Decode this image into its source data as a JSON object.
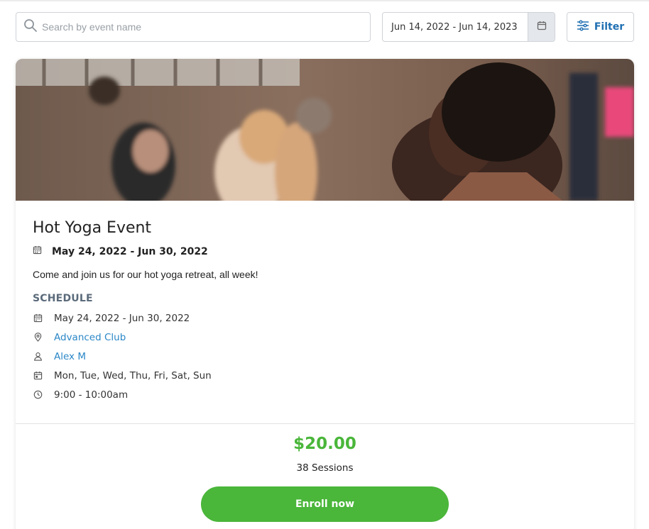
{
  "toolbar": {
    "search_placeholder": "Search by event name",
    "search_value": "",
    "date_range": "Jun 14, 2022 - Jun 14, 2023",
    "filter_label": "Filter"
  },
  "event": {
    "title": "Hot Yoga Event",
    "date_range": "May 24, 2022 - Jun 30, 2022",
    "description": "Come and join us for our hot yoga retreat, all week!",
    "schedule_heading": "SCHEDULE",
    "schedule": {
      "dates": "May 24, 2022 - Jun 30, 2022",
      "location": "Advanced Club",
      "instructor": "Alex M",
      "days": "Mon, Tue, Wed, Thu, Fri, Sat, Sun",
      "time": "9:00 - 10:00am"
    },
    "price": "$20.00",
    "sessions": "38 Sessions",
    "enroll_label": "Enroll now"
  },
  "icons": {
    "search": "search-icon",
    "calendar": "calendar-icon",
    "filter": "sliders-icon",
    "location": "map-pin-icon",
    "instructor": "user-icon",
    "days": "calendar-day-icon",
    "time": "clock-icon"
  },
  "colors": {
    "accent_green": "#4ab63a",
    "link_blue": "#2b87c7",
    "filter_blue": "#1f6fb2",
    "schedule_heading": "#5a6a7a"
  }
}
